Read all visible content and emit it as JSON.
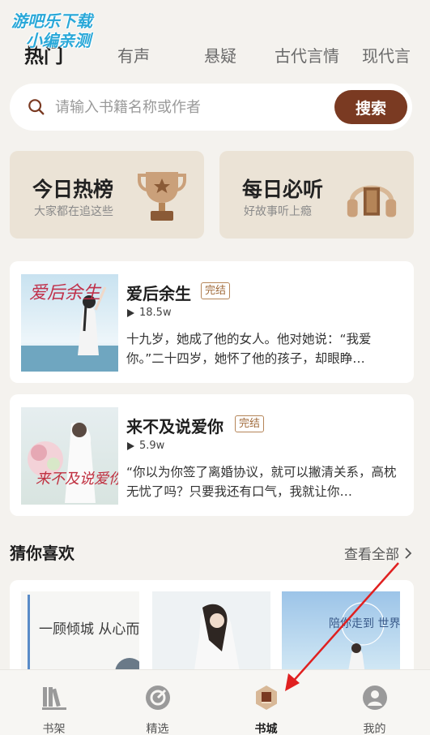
{
  "watermark": {
    "line1": "游吧乐下载",
    "line2": "小编亲测"
  },
  "tabs": [
    "热门",
    "有声",
    "悬疑",
    "古代言情",
    "现代言"
  ],
  "search": {
    "placeholder": "请输入书籍名称或作者",
    "button": "搜索"
  },
  "promos": [
    {
      "title": "今日热榜",
      "subtitle": "大家都在追这些",
      "icon": "trophy-icon"
    },
    {
      "title": "每日必听",
      "subtitle": "好故事听上瘾",
      "icon": "headphones-icon"
    }
  ],
  "books": [
    {
      "title": "爱后余生",
      "badge": "完结",
      "plays": "18.5w",
      "desc": "十九岁，她成了他的女人。他对她说：“我爱你。”二十四岁，她怀了他的孩子，却眼睁…",
      "cover_text": "爱后余生"
    },
    {
      "title": "来不及说爱你",
      "badge": "完结",
      "plays": "5.9w",
      "desc": "“你以为你签了离婚协议，就可以撇清关系，高枕无忧了吗？只要我还有口气，我就让你…",
      "cover_text": "来不及说爱你"
    }
  ],
  "recommend": {
    "title": "猜你喜欢",
    "see_all": "查看全部",
    "covers": [
      {
        "text": "一顾倾城 从心而安"
      },
      {
        "text": ""
      },
      {
        "text": "陪你走到 世界尽头"
      }
    ]
  },
  "nav": [
    {
      "label": "书架",
      "icon": "bookshelf-icon"
    },
    {
      "label": "精选",
      "icon": "compass-icon"
    },
    {
      "label": "书城",
      "icon": "book-store-icon",
      "active": true
    },
    {
      "label": "我的",
      "icon": "profile-icon"
    }
  ],
  "colors": {
    "accent": "#7a3a22",
    "badge": "#b58558",
    "background": "#f4f2ee",
    "annotation_arrow": "#e02020"
  }
}
